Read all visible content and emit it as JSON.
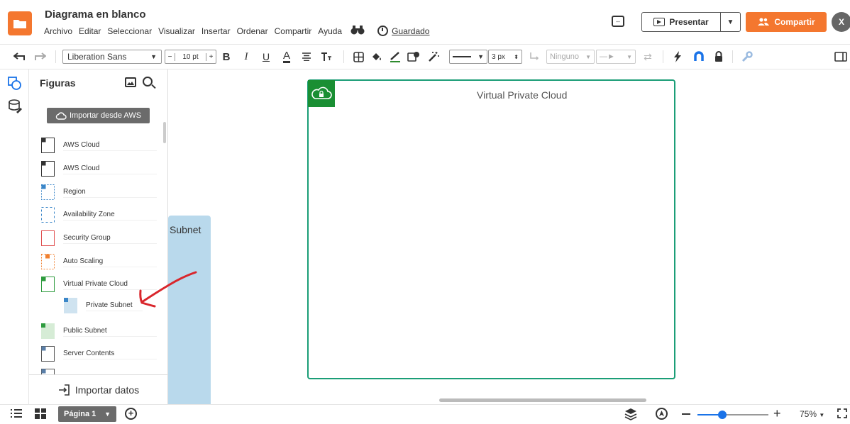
{
  "header": {
    "doc_title": "Diagrama en blanco",
    "menu": [
      "Archivo",
      "Editar",
      "Seleccionar",
      "Visualizar",
      "Insertar",
      "Ordenar",
      "Compartir",
      "Ayuda"
    ],
    "saved_label": "Guardado",
    "present_label": "Presentar",
    "share_label": "Compartir",
    "avatar_initial": "X"
  },
  "toolbar": {
    "font_family": "Liberation Sans",
    "font_size": "10 pt",
    "size_minus": "−",
    "size_plus": "+",
    "bold": "B",
    "italic": "I",
    "underline": "U",
    "text_color": "A",
    "line_width": "3 px",
    "line_start": "Ninguno"
  },
  "panel": {
    "title": "Figuras",
    "aws_import_label": "Importar desde AWS",
    "import_data_label": "Importar datos",
    "shapes": [
      {
        "label": "AWS Cloud",
        "style": "cloud-dark"
      },
      {
        "label": "AWS Cloud",
        "style": "cloud-dark"
      },
      {
        "label": "Region",
        "style": "region"
      },
      {
        "label": "Availability Zone",
        "style": "az"
      },
      {
        "label": "Security Group",
        "style": "sg"
      },
      {
        "label": "Auto Scaling",
        "style": "autoscaling"
      },
      {
        "label": "Virtual Private Cloud",
        "style": "vpc"
      },
      {
        "label": "Private Subnet",
        "style": "private-subnet"
      },
      {
        "label": "Public Subnet",
        "style": "public-subnet"
      },
      {
        "label": "Server Contents",
        "style": "server"
      }
    ]
  },
  "canvas": {
    "subnet_label": "Subnet",
    "vpc_title": "Virtual Private Cloud"
  },
  "bottom": {
    "page_label": "Página 1",
    "zoom_label": "75%",
    "zoom_fraction": 0.35
  },
  "colors": {
    "accent_orange": "#f4772f",
    "vpc_green": "#1b9e77",
    "badge_green": "#1a8f33",
    "annotation_red": "#d9262c"
  }
}
